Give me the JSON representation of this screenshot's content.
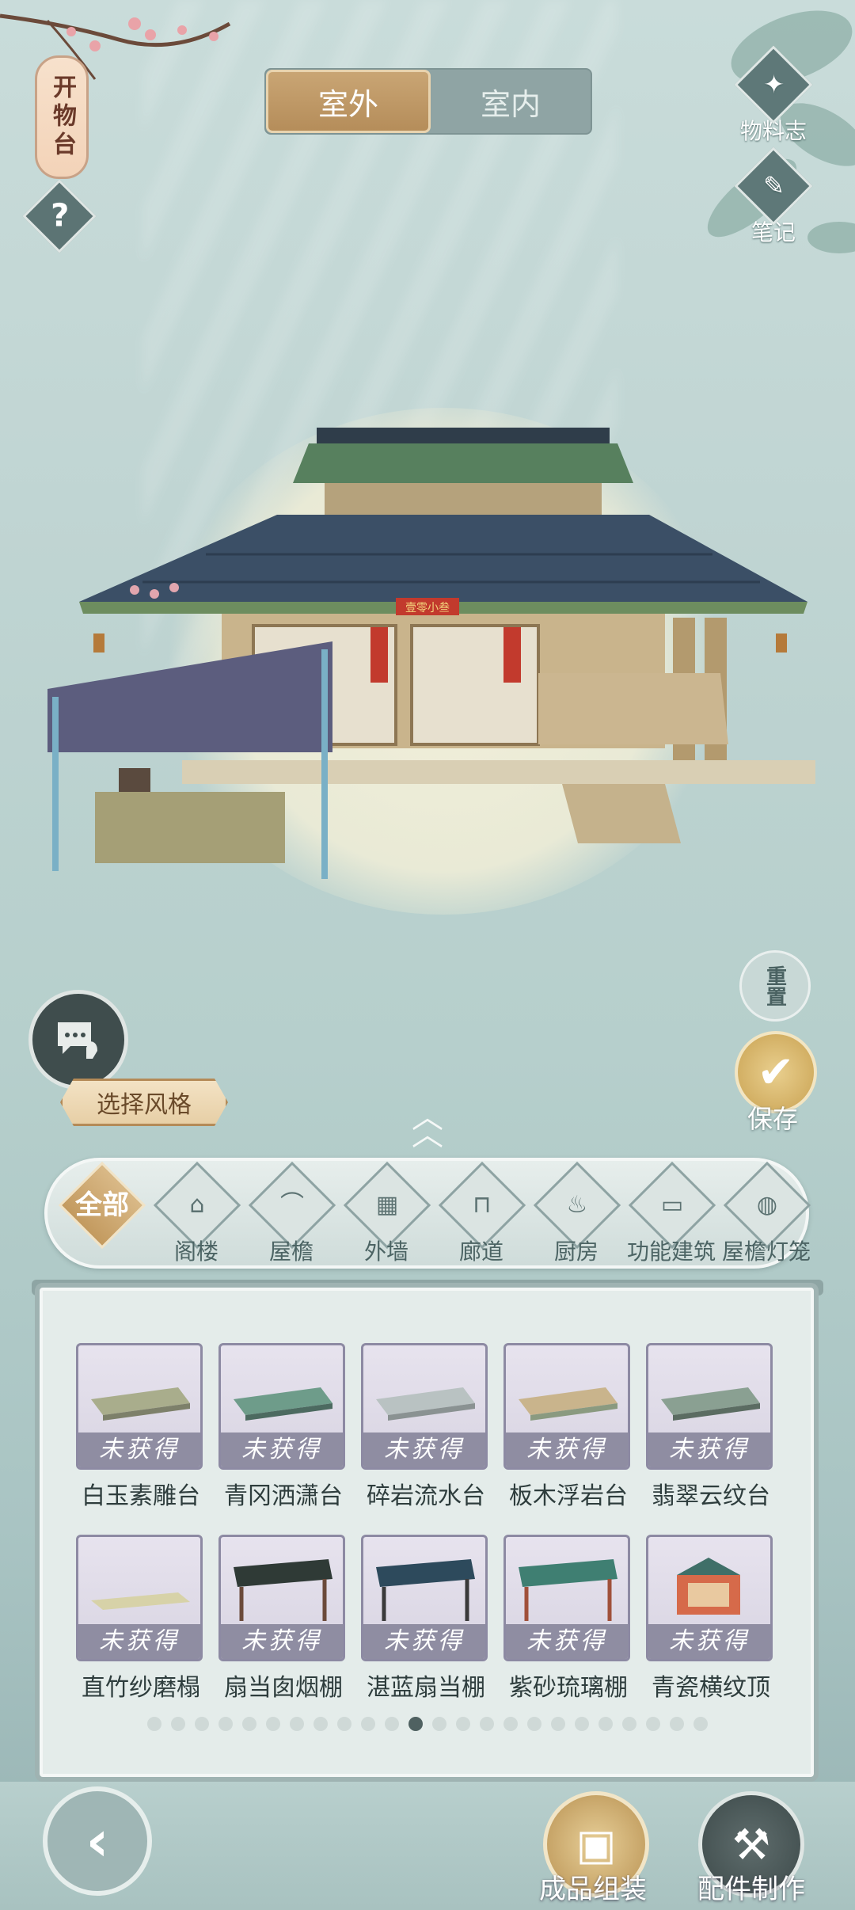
{
  "top_left": {
    "lantern_label": "开物台",
    "help_label": "?"
  },
  "tabs": [
    {
      "label": "室外",
      "active": true
    },
    {
      "label": "室内",
      "active": false
    }
  ],
  "top_right": {
    "materials_label": "物料志",
    "notes_label": "笔记"
  },
  "scene": {
    "shop_plaque": "壹零小叁"
  },
  "controls": {
    "select_style_label": "选择风格",
    "reset_label": "重置",
    "save_label": "保存",
    "expand_icon": "double-chevron-up-icon"
  },
  "categories": [
    {
      "label": "全部",
      "active": true
    },
    {
      "label": "阁楼"
    },
    {
      "label": "屋檐"
    },
    {
      "label": "外墙"
    },
    {
      "label": "廊道"
    },
    {
      "label": "厨房"
    },
    {
      "label": "功能建筑"
    },
    {
      "label": "屋檐灯笼"
    }
  ],
  "items": [
    {
      "name": "白玉素雕台",
      "status": "未获得"
    },
    {
      "name": "青冈洒潇台",
      "status": "未获得"
    },
    {
      "name": "碎岩流水台",
      "status": "未获得"
    },
    {
      "name": "板木浮岩台",
      "status": "未获得"
    },
    {
      "name": "翡翠云纹台",
      "status": "未获得"
    },
    {
      "name": "直竹纱磨榻",
      "status": "未获得"
    },
    {
      "name": "扇当囱烟棚",
      "status": "未获得"
    },
    {
      "name": "湛蓝扇当棚",
      "status": "未获得"
    },
    {
      "name": "紫砂琉璃棚",
      "status": "未获得"
    },
    {
      "name": "青瓷横纹顶",
      "status": "未获得"
    }
  ],
  "pagination": {
    "total": 24,
    "current": 11
  },
  "bottom": {
    "assemble_label": "成品组装",
    "craft_label": "配件制作"
  },
  "colors": {
    "accent_gold": "#c39a5f",
    "panel_bg": "#e4ecea",
    "locked_bar": "#8f8da2"
  }
}
